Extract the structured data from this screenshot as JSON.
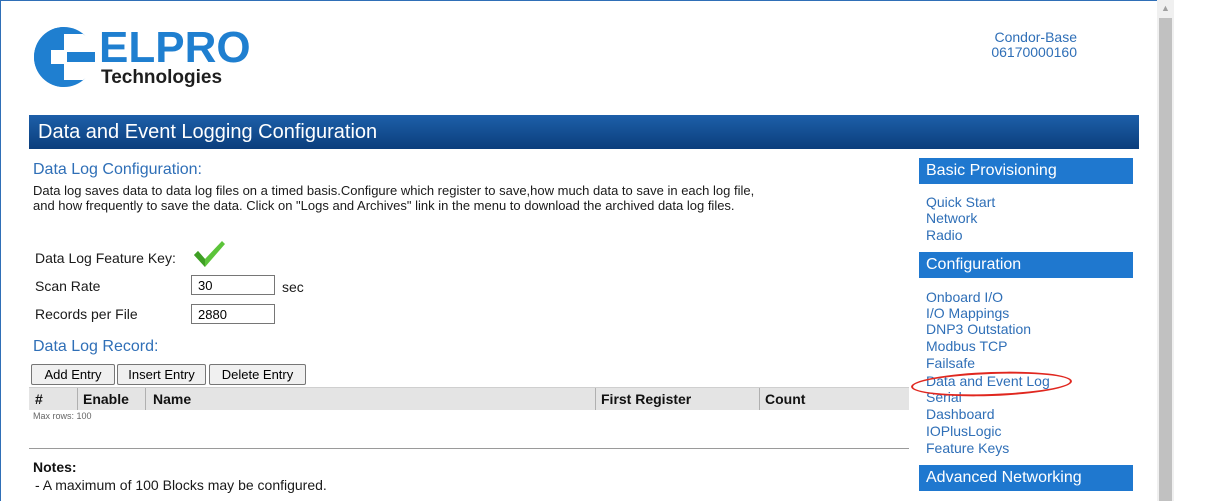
{
  "brand": {
    "name": "ELPRO",
    "subtitle": "Technologies",
    "colors": {
      "primary": "#1f7fd0",
      "header_dark": "#0b3e7c"
    }
  },
  "device": {
    "name": "Condor-Base",
    "serial": "06170000160"
  },
  "page_title": "Data and Event Logging Configuration",
  "data_log": {
    "section_title": "Data Log Configuration:",
    "description_line1": "Data log saves data to data log files on a timed basis.Configure which register to save,how much data to save in each log file,",
    "description_line2": "and how frequently to save the data. Click on \"Logs and Archives\" link in the menu to download the archived data log files.",
    "feature_key_label": "Data Log Feature Key:",
    "feature_key_icon": "checkmark-icon",
    "scan_rate_label": "Scan Rate",
    "scan_rate_value": "30",
    "scan_rate_unit": "sec",
    "records_label": "Records per File",
    "records_value": "2880"
  },
  "record": {
    "section_title": "Data Log Record:",
    "buttons": {
      "add": "Add Entry",
      "insert": "Insert Entry",
      "delete": "Delete Entry"
    },
    "columns": [
      "#",
      "Enable",
      "Name",
      "First Register",
      "Count"
    ],
    "max_rows": "Max rows: 100"
  },
  "notes": {
    "title": "Notes:",
    "items": [
      " - A maximum of 100 Blocks may be configured."
    ]
  },
  "sidebar": {
    "basic": {
      "title": "Basic Provisioning",
      "items": [
        "Quick Start",
        "Network",
        "Radio"
      ]
    },
    "config": {
      "title": "Configuration",
      "items": [
        "Onboard I/O",
        "I/O Mappings",
        "DNP3 Outstation",
        "Modbus TCP",
        "Failsafe",
        "Data and Event Log",
        "Serial",
        "Dashboard",
        "IOPlusLogic",
        "Feature Keys"
      ]
    },
    "advanced": {
      "title": "Advanced Networking"
    },
    "highlight_color": "#e0271f"
  }
}
